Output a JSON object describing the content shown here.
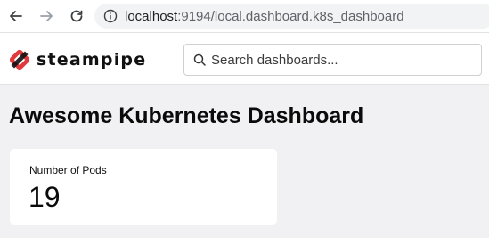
{
  "browser": {
    "url_host": "localhost",
    "url_rest": ":9194/local.dashboard.k8s_dashboard",
    "icons": [
      "back-arrow-icon",
      "forward-arrow-icon",
      "reload-icon",
      "info-icon"
    ]
  },
  "app": {
    "logo_text": "steampipe",
    "search_placeholder": "Search dashboards...",
    "accent_color": "#e03a3e"
  },
  "dashboard": {
    "title": "Awesome Kubernetes Dashboard",
    "cards": [
      {
        "label": "Number of Pods",
        "value": "19"
      }
    ]
  }
}
